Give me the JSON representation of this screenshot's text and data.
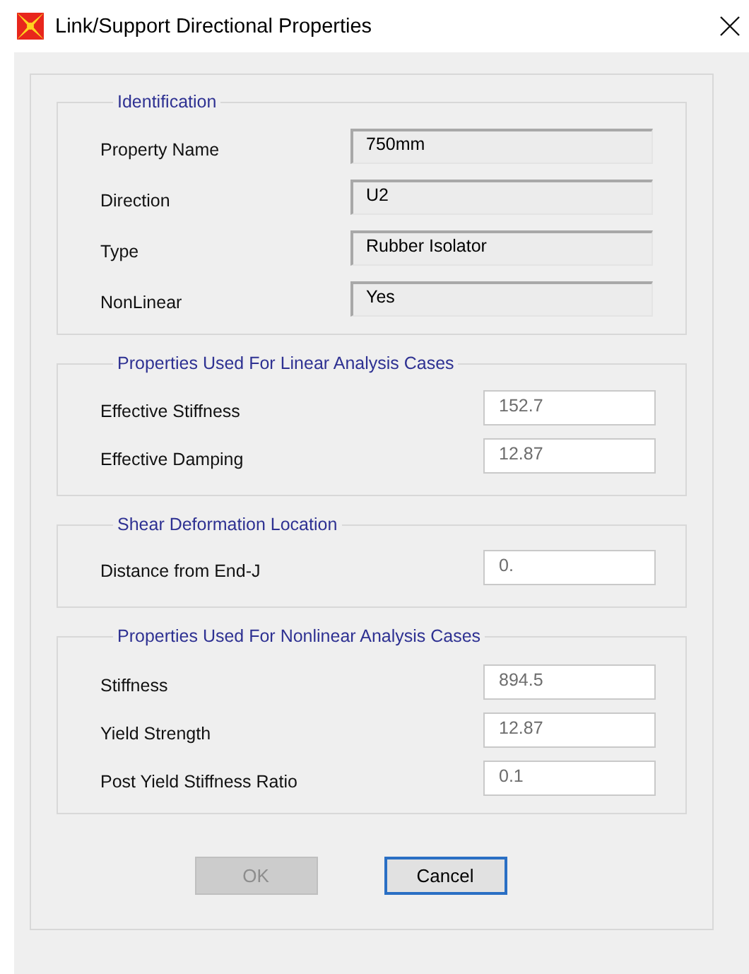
{
  "window": {
    "title": "Link/Support Directional Properties"
  },
  "groups": [
    {
      "title": "Identification",
      "fields": [
        {
          "label": "Property Name",
          "value": "750mm",
          "kind": "readonly"
        },
        {
          "label": "Direction",
          "value": "U2",
          "kind": "readonly"
        },
        {
          "label": "Type",
          "value": "Rubber Isolator",
          "kind": "readonly"
        },
        {
          "label": "NonLinear",
          "value": "Yes",
          "kind": "readonly"
        }
      ]
    },
    {
      "title": "Properties Used For Linear Analysis Cases",
      "fields": [
        {
          "label": "Effective Stiffness",
          "value": "152.7",
          "kind": "entry"
        },
        {
          "label": "Effective Damping",
          "value": "12.87",
          "kind": "entry"
        }
      ]
    },
    {
      "title": "Shear Deformation Location",
      "fields": [
        {
          "label": "Distance from End-J",
          "value": "0.",
          "kind": "entry"
        }
      ]
    },
    {
      "title": "Properties Used For Nonlinear Analysis Cases",
      "fields": [
        {
          "label": "Stiffness",
          "value": "894.5",
          "kind": "entry"
        },
        {
          "label": "Yield Strength",
          "value": "12.87",
          "kind": "entry"
        },
        {
          "label": "Post Yield Stiffness Ratio",
          "value": "0.1",
          "kind": "entry"
        }
      ]
    }
  ],
  "buttons": [
    {
      "label": "OK",
      "disabled": true,
      "focused": false
    },
    {
      "label": "Cancel",
      "disabled": false,
      "focused": true
    }
  ]
}
